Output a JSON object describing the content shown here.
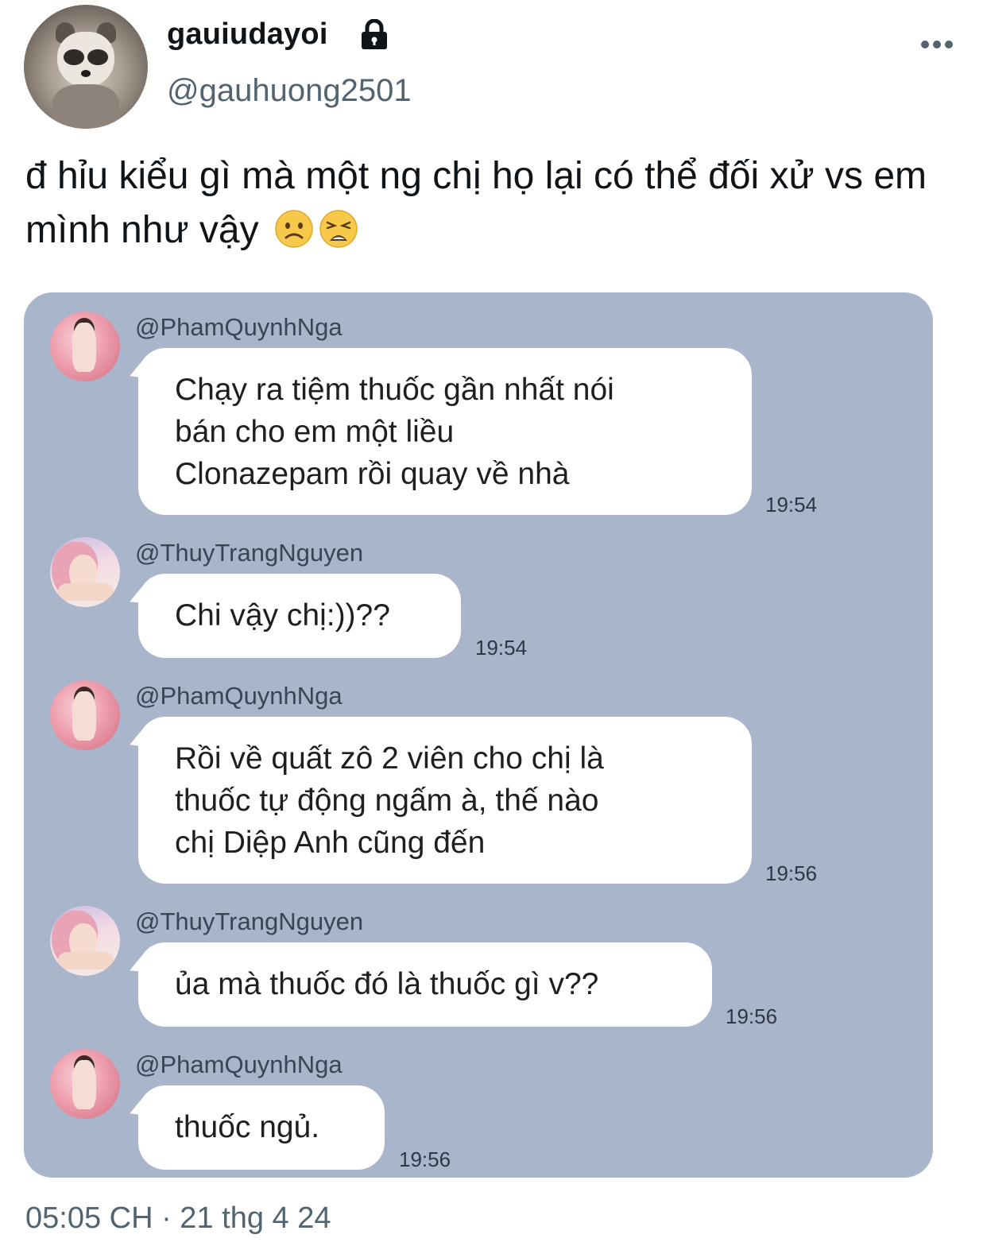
{
  "user": {
    "display_name": "gauiudayoi",
    "handle": "@gauhuong2501",
    "avatar_icon": "raccoon-avatar",
    "locked_icon": "lock-icon"
  },
  "tweet": {
    "text": "đ hỉu kiểu gì mà một ng chị họ lại có thể đối xử vs em mình như vậy",
    "emojis": [
      "slightly-frowning-face",
      "weary-face"
    ],
    "timestamp": "05:05 CH · 21 thg 4 24"
  },
  "chat": {
    "messages": [
      {
        "sender": "@PhamQuynhNga",
        "text": "Chạy ra tiệm thuốc gần nhất nói\nbán cho em một liều\nClonazepam rồi quay về nhà",
        "time": "19:54"
      },
      {
        "sender": "@ThuyTrangNguyen",
        "text": "Chi vậy chị:))??",
        "time": "19:54"
      },
      {
        "sender": "@PhamQuynhNga",
        "text": "Rồi về quất zô 2 viên cho chị là\nthuốc tự động ngấm à, thế nào\nchị Diệp Anh cũng đến",
        "time": "19:56"
      },
      {
        "sender": "@ThuyTrangNguyen",
        "text": "ủa mà thuốc đó là thuốc gì v??",
        "time": "19:56"
      },
      {
        "sender": "@PhamQuynhNga",
        "text": "thuốc ngủ.",
        "time": "19:56"
      }
    ]
  }
}
